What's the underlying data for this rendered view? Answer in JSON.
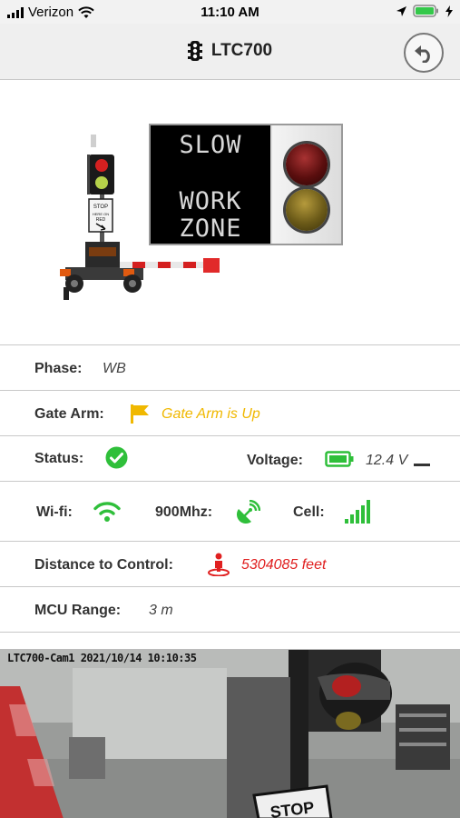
{
  "status_bar": {
    "carrier": "Verizon",
    "time": "11:10 AM"
  },
  "header": {
    "title": "LTC700",
    "title_icon": "traffic-light-icon",
    "back_icon": "back-arrow-icon"
  },
  "sign": {
    "line1": "SLOW",
    "line2": "WORK",
    "line3": "ZONE",
    "lights": [
      "red",
      "yellow"
    ]
  },
  "details": {
    "phase": {
      "label": "Phase:",
      "value": "WB"
    },
    "gate_arm": {
      "label": "Gate Arm:",
      "value": "Gate Arm is Up",
      "icon": "flag-icon"
    },
    "status": {
      "label": "Status:",
      "icon": "check-circle-icon"
    },
    "voltage": {
      "label": "Voltage:",
      "value": "12.4 V",
      "icon": "battery-icon"
    },
    "wifi": {
      "label": "Wi-fi:",
      "icon": "wifi-icon"
    },
    "radio": {
      "label": "900Mhz:",
      "icon": "satellite-icon"
    },
    "cell": {
      "label": "Cell:",
      "icon": "cell-signal-icon"
    },
    "distance": {
      "label": "Distance to Control:",
      "value": "5304085 feet",
      "icon": "person-location-icon"
    },
    "mcu_range": {
      "label": "MCU Range:",
      "value": "3 m"
    }
  },
  "camera": {
    "overlay": "LTC700-Cam1 2021/10/14 10:10:35"
  },
  "colors": {
    "green": "#2fbf3a",
    "yellow": "#f0b800",
    "red": "#e02020",
    "header_bg": "#efefef"
  }
}
